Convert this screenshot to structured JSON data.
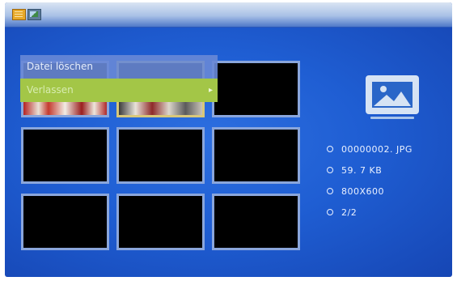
{
  "menu": {
    "items": [
      {
        "label": "Datei löschen"
      },
      {
        "label": "Verlassen"
      }
    ]
  },
  "file_info": {
    "filename": "00000002. JPG",
    "size": "59. 7 KB",
    "resolution": "800X600",
    "position": "2/2"
  },
  "icons": {
    "folder_tab": "folder-icon",
    "photo_tab": "photo-icon",
    "preview": "image-placeholder-icon",
    "menu_arrow": "chevron-right-icon"
  },
  "colors": {
    "background": "#1f5ed3",
    "menu_highlight": "#a3c647",
    "menu_item": "#6888d6",
    "thumb_border": "#8aa6dc",
    "thumb_selected_border": "#d8c77a"
  }
}
